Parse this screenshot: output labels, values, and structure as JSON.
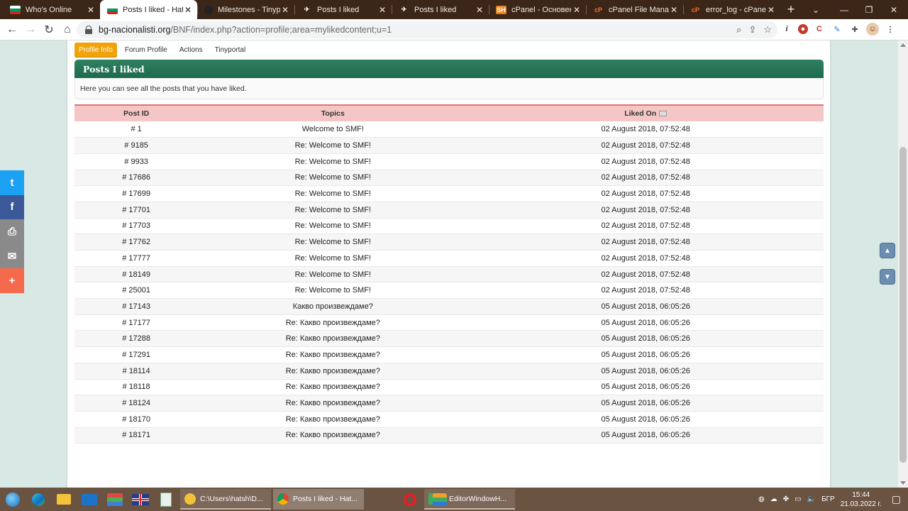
{
  "browser": {
    "tabs": [
      {
        "title": "Who's Online",
        "icon": "bulgaria-flag-icon",
        "active": false
      },
      {
        "title": "Posts I liked - Hatsh",
        "icon": "bulgaria-flag-icon",
        "active": true
      },
      {
        "title": "Milestones - Tinyportal",
        "icon": "github-icon",
        "active": false
      },
      {
        "title": "Posts I liked",
        "icon": "site-icon",
        "active": false
      },
      {
        "title": "Posts I liked",
        "icon": "site-icon",
        "active": false
      },
      {
        "title": "cPanel - Основен",
        "icon": "sh-icon",
        "active": false
      },
      {
        "title": "cPanel File Manager",
        "icon": "cpanel-icon",
        "active": false
      },
      {
        "title": "error_log - cPanel F",
        "icon": "cpanel-icon",
        "active": false
      }
    ],
    "url_host": "bg-nacionalisti.org",
    "url_path": "/BNF/index.php?action=profile;area=mylikedcontent;u=1"
  },
  "profile_nav": {
    "items": [
      "Profile Info",
      "Forum Profile",
      "Actions",
      "Tinyportal"
    ],
    "active_index": 0
  },
  "section": {
    "title": "Posts I liked",
    "description": "Here you can see all the posts that you have liked."
  },
  "table": {
    "headers": {
      "post_id": "Post ID",
      "topics": "Topics",
      "liked_on": "Liked On"
    },
    "rows": [
      {
        "id": "# 1",
        "topic": "Welcome to SMF!",
        "date": "02 August 2018, 07:52:48"
      },
      {
        "id": "# 9185",
        "topic": "Re: Welcome to SMF!",
        "date": "02 August 2018, 07:52:48"
      },
      {
        "id": "# 9933",
        "topic": "Re: Welcome to SMF!",
        "date": "02 August 2018, 07:52:48"
      },
      {
        "id": "# 17686",
        "topic": "Re: Welcome to SMF!",
        "date": "02 August 2018, 07:52:48"
      },
      {
        "id": "# 17699",
        "topic": "Re: Welcome to SMF!",
        "date": "02 August 2018, 07:52:48"
      },
      {
        "id": "# 17701",
        "topic": "Re: Welcome to SMF!",
        "date": "02 August 2018, 07:52:48"
      },
      {
        "id": "# 17703",
        "topic": "Re: Welcome to SMF!",
        "date": "02 August 2018, 07:52:48"
      },
      {
        "id": "# 17762",
        "topic": "Re: Welcome to SMF!",
        "date": "02 August 2018, 07:52:48"
      },
      {
        "id": "# 17777",
        "topic": "Re: Welcome to SMF!",
        "date": "02 August 2018, 07:52:48"
      },
      {
        "id": "# 18149",
        "topic": "Re: Welcome to SMF!",
        "date": "02 August 2018, 07:52:48"
      },
      {
        "id": "# 25001",
        "topic": "Re: Welcome to SMF!",
        "date": "02 August 2018, 07:52:48"
      },
      {
        "id": "# 17143",
        "topic": "Какво произвеждаме?",
        "date": "05 August 2018, 06:05:26"
      },
      {
        "id": "# 17177",
        "topic": "Re: Какво произвеждаме?",
        "date": "05 August 2018, 06:05:26"
      },
      {
        "id": "# 17288",
        "topic": "Re: Какво произвеждаме?",
        "date": "05 August 2018, 06:05:26"
      },
      {
        "id": "# 17291",
        "topic": "Re: Какво произвеждаме?",
        "date": "05 August 2018, 06:05:26"
      },
      {
        "id": "# 18114",
        "topic": "Re: Какво произвеждаме?",
        "date": "05 August 2018, 06:05:26"
      },
      {
        "id": "# 18118",
        "topic": "Re: Какво произвеждаме?",
        "date": "05 August 2018, 06:05:26"
      },
      {
        "id": "# 18124",
        "topic": "Re: Какво произвеждаме?",
        "date": "05 August 2018, 06:05:26"
      },
      {
        "id": "# 18170",
        "topic": "Re: Какво произвеждаме?",
        "date": "05 August 2018, 06:05:26"
      },
      {
        "id": "# 18171",
        "topic": "Re: Какво произвеждаме?",
        "date": "05 August 2018, 06:05:26"
      }
    ]
  },
  "share_buttons": [
    {
      "name": "twitter",
      "glyph": "t",
      "color": "#1da1f2"
    },
    {
      "name": "facebook",
      "glyph": "f",
      "color": "#3b5998"
    },
    {
      "name": "print",
      "glyph": "⎙",
      "color": "#8a8a8a"
    },
    {
      "name": "email",
      "glyph": "✉",
      "color": "#8a8a8a"
    },
    {
      "name": "more",
      "glyph": "+",
      "color": "#f5694d"
    }
  ],
  "taskbar": {
    "apps": [
      {
        "label": "C:\\Users\\hatsh\\D...",
        "icon": "folder-icon",
        "state": "open"
      },
      {
        "label": "Posts I liked - Hat...",
        "icon": "chrome-icon",
        "state": "active"
      },
      {
        "label": "* EditorWindowH...",
        "icon": "editor-icon",
        "state": "open"
      }
    ],
    "language": "БГР",
    "time": "15:44",
    "date": "21.03.2022 г."
  }
}
